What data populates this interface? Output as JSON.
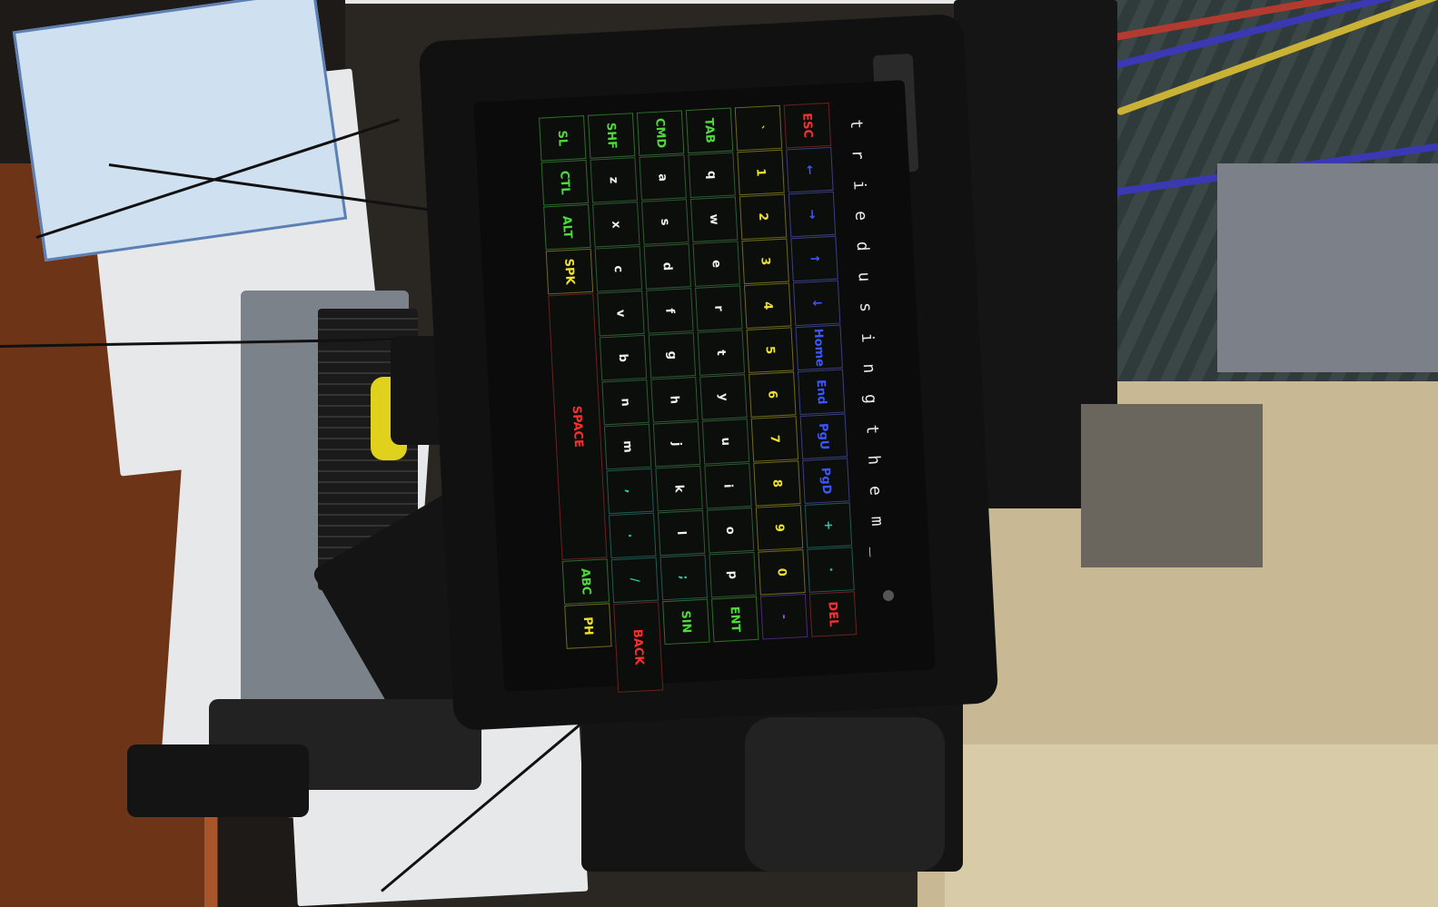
{
  "typed_text": "t r i e d   u s i n g   t h e   m _",
  "keyboard": {
    "rows": [
      [
        {
          "label": "ESC",
          "color": "red"
        },
        {
          "label": "←",
          "color": "blue"
        },
        {
          "label": "→",
          "color": "blue"
        },
        {
          "label": "↑",
          "color": "blue"
        },
        {
          "label": "↓",
          "color": "blue"
        },
        {
          "label": "Home",
          "color": "blue"
        },
        {
          "label": "End",
          "color": "blue"
        },
        {
          "label": "PgU",
          "color": "blue"
        },
        {
          "label": "PgD",
          "color": "blue"
        },
        {
          "label": "+",
          "color": "cyan"
        },
        {
          "label": "·",
          "color": "cyan"
        },
        {
          "label": "DEL",
          "color": "red"
        }
      ],
      [
        {
          "label": "`",
          "color": "yellow"
        },
        {
          "label": "1",
          "color": "yellow"
        },
        {
          "label": "2",
          "color": "yellow"
        },
        {
          "label": "3",
          "color": "yellow"
        },
        {
          "label": "4",
          "color": "yellow"
        },
        {
          "label": "5",
          "color": "yellow"
        },
        {
          "label": "6",
          "color": "yellow"
        },
        {
          "label": "7",
          "color": "yellow"
        },
        {
          "label": "8",
          "color": "yellow"
        },
        {
          "label": "9",
          "color": "yellow"
        },
        {
          "label": "0",
          "color": "yellow"
        },
        {
          "label": "-",
          "color": "purple"
        }
      ],
      [
        {
          "label": "TAB",
          "color": "green"
        },
        {
          "label": "q",
          "color": "white"
        },
        {
          "label": "w",
          "color": "white"
        },
        {
          "label": "e",
          "color": "white"
        },
        {
          "label": "r",
          "color": "white"
        },
        {
          "label": "t",
          "color": "white"
        },
        {
          "label": "y",
          "color": "white"
        },
        {
          "label": "u",
          "color": "white"
        },
        {
          "label": "i",
          "color": "white"
        },
        {
          "label": "o",
          "color": "white"
        },
        {
          "label": "p",
          "color": "white"
        },
        {
          "label": "ENT",
          "color": "green"
        }
      ],
      [
        {
          "label": "CMD",
          "color": "green"
        },
        {
          "label": "a",
          "color": "white"
        },
        {
          "label": "s",
          "color": "white"
        },
        {
          "label": "d",
          "color": "white"
        },
        {
          "label": "f",
          "color": "white"
        },
        {
          "label": "g",
          "color": "white"
        },
        {
          "label": "h",
          "color": "white"
        },
        {
          "label": "j",
          "color": "white"
        },
        {
          "label": "k",
          "color": "white"
        },
        {
          "label": "l",
          "color": "white"
        },
        {
          "label": ";",
          "color": "cyan"
        },
        {
          "label": "SIN",
          "color": "green"
        }
      ],
      [
        {
          "label": "SHF",
          "color": "green"
        },
        {
          "label": "z",
          "color": "white"
        },
        {
          "label": "x",
          "color": "white"
        },
        {
          "label": "c",
          "color": "white"
        },
        {
          "label": "v",
          "color": "white"
        },
        {
          "label": "b",
          "color": "white"
        },
        {
          "label": "n",
          "color": "white"
        },
        {
          "label": "m",
          "color": "white"
        },
        {
          "label": ",",
          "color": "cyan"
        },
        {
          "label": ".",
          "color": "cyan"
        },
        {
          "label": "/",
          "color": "cyan"
        },
        {
          "label": "BACK",
          "color": "red"
        }
      ],
      [
        {
          "label": "SL",
          "color": "green"
        },
        {
          "label": "CTL",
          "color": "green"
        },
        {
          "label": "ALT",
          "color": "green"
        },
        {
          "label": "SPK",
          "color": "yellow"
        },
        {
          "label": "SPACE",
          "color": "red"
        },
        {
          "label": "ABC",
          "color": "green"
        },
        {
          "label": "PH",
          "color": "yellow"
        }
      ]
    ]
  }
}
